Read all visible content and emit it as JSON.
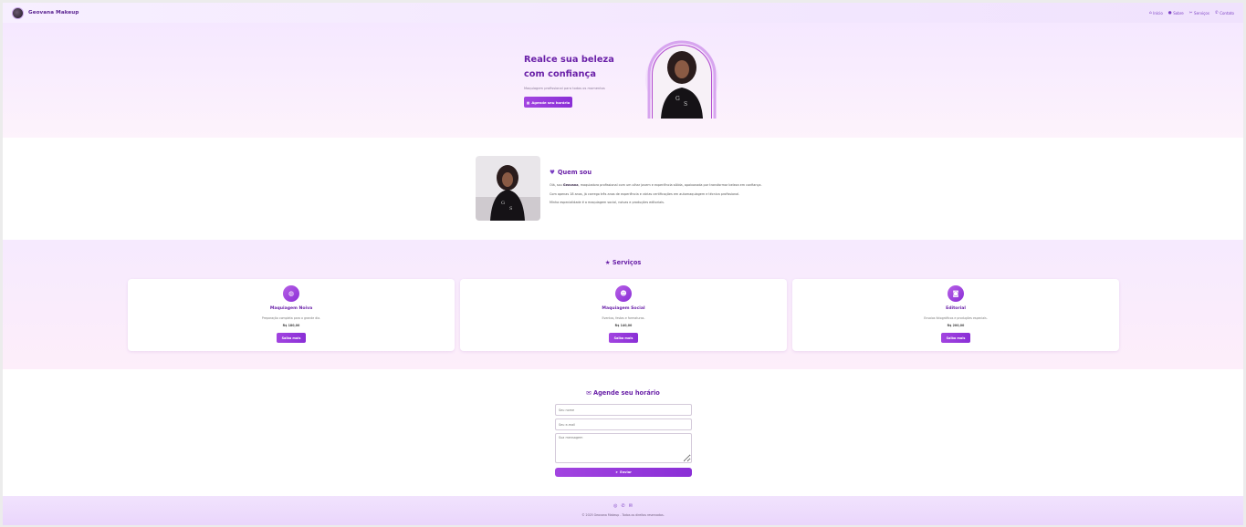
{
  "brand": {
    "name": "Geovana Makeup"
  },
  "nav": {
    "items": [
      {
        "label": "Início",
        "icon": "home-icon"
      },
      {
        "label": "Sobre",
        "icon": "user-icon"
      },
      {
        "label": "Serviços",
        "icon": "tools-icon"
      },
      {
        "label": "Contato",
        "icon": "phone-icon"
      }
    ]
  },
  "hero": {
    "title": "Realce sua beleza com confiança",
    "subtitle": "Maquiagem profissional para todos os momentos",
    "button": "Agende seu horário"
  },
  "about": {
    "title": "Quem sou",
    "p1_prefix": "Olá, sou ",
    "p1_name": "Geovana",
    "p1_suffix": ", maquiadora profissional com um olhar jovem e experiência sólida, apaixonada por transformar beleza em confiança.",
    "p2": "Com apenas 18 anos, já carrego três anos de experiência e várias certificações em automaquiagem e técnica profissional.",
    "p3": "Minha especialidade é a maquiagem social, noivas e produções editoriais."
  },
  "services": {
    "title": "Serviços",
    "cards": [
      {
        "title": "Maquiagem Noiva",
        "desc": "Preparação completa para o grande dia.",
        "price": "R$ 180,00",
        "button": "Saiba mais",
        "icon": "ring-icon"
      },
      {
        "title": "Maquiagem Social",
        "desc": "Eventos, festas e formaturas.",
        "price": "R$ 140,00",
        "button": "Saiba mais",
        "icon": "people-icon"
      },
      {
        "title": "Editorial",
        "desc": "Ensaios fotográficos e produções especiais.",
        "price": "R$ 200,00",
        "button": "Saiba mais",
        "icon": "camera-icon"
      }
    ]
  },
  "contact": {
    "title": "Agende seu horário",
    "name_placeholder": "Seu nome",
    "email_placeholder": "Seu e-mail",
    "message_placeholder": "Sua mensagem",
    "send": "Enviar"
  },
  "footer": {
    "copyright": "© 2025 Geovana Makeup - Todos os direitos reservados."
  },
  "colors": {
    "accent": "#8a2fd6",
    "heading": "#6a21a8"
  }
}
